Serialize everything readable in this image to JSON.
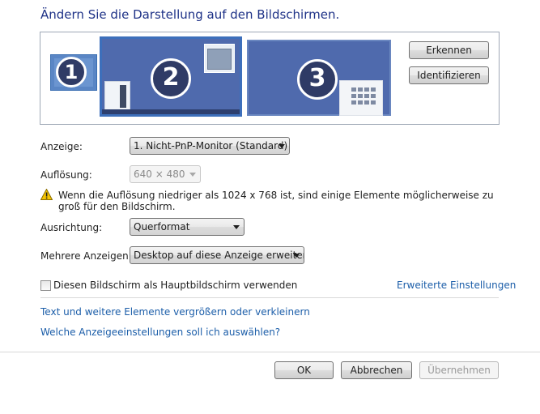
{
  "heading": "Ändern Sie die Darstellung auf den Bildschirmen.",
  "monitors": [
    {
      "number": "1"
    },
    {
      "number": "2"
    },
    {
      "number": "3"
    }
  ],
  "buttons": {
    "detect": "Erkennen",
    "identify": "Identifizieren",
    "ok": "OK",
    "cancel": "Abbrechen",
    "apply": "Übernehmen"
  },
  "display": {
    "label": "Anzeige:",
    "value": "1. Nicht-PnP-Monitor (Standard)"
  },
  "resolution": {
    "label": "Auflösung:",
    "value": "640 × 480"
  },
  "warning": {
    "text": "Wenn die Auflösung niedriger als 1024 x 768 ist, sind einige Elemente möglicherweise zu groß für den Bildschirm.",
    "icon": "warning-icon",
    "color": "#f5c400"
  },
  "orientation": {
    "label": "Ausrichtung:",
    "value": "Querformat"
  },
  "multiple": {
    "label": "Mehrere Anzeigen:",
    "value": "Desktop auf diese Anzeige erweitern"
  },
  "main_display": {
    "label": "Diesen Bildschirm als Hauptbildschirm verwenden",
    "checked": false
  },
  "links": {
    "advanced": "Erweiterte Einstellungen",
    "text_size": "Text und weitere Elemente vergrößern oder verkleinern",
    "which_settings": "Welche Anzeigeeinstellungen soll ich auswählen?"
  },
  "colors": {
    "heading": "#1e3287",
    "link": "#1c5ea9",
    "monitor_fill": "#4f6aad"
  }
}
